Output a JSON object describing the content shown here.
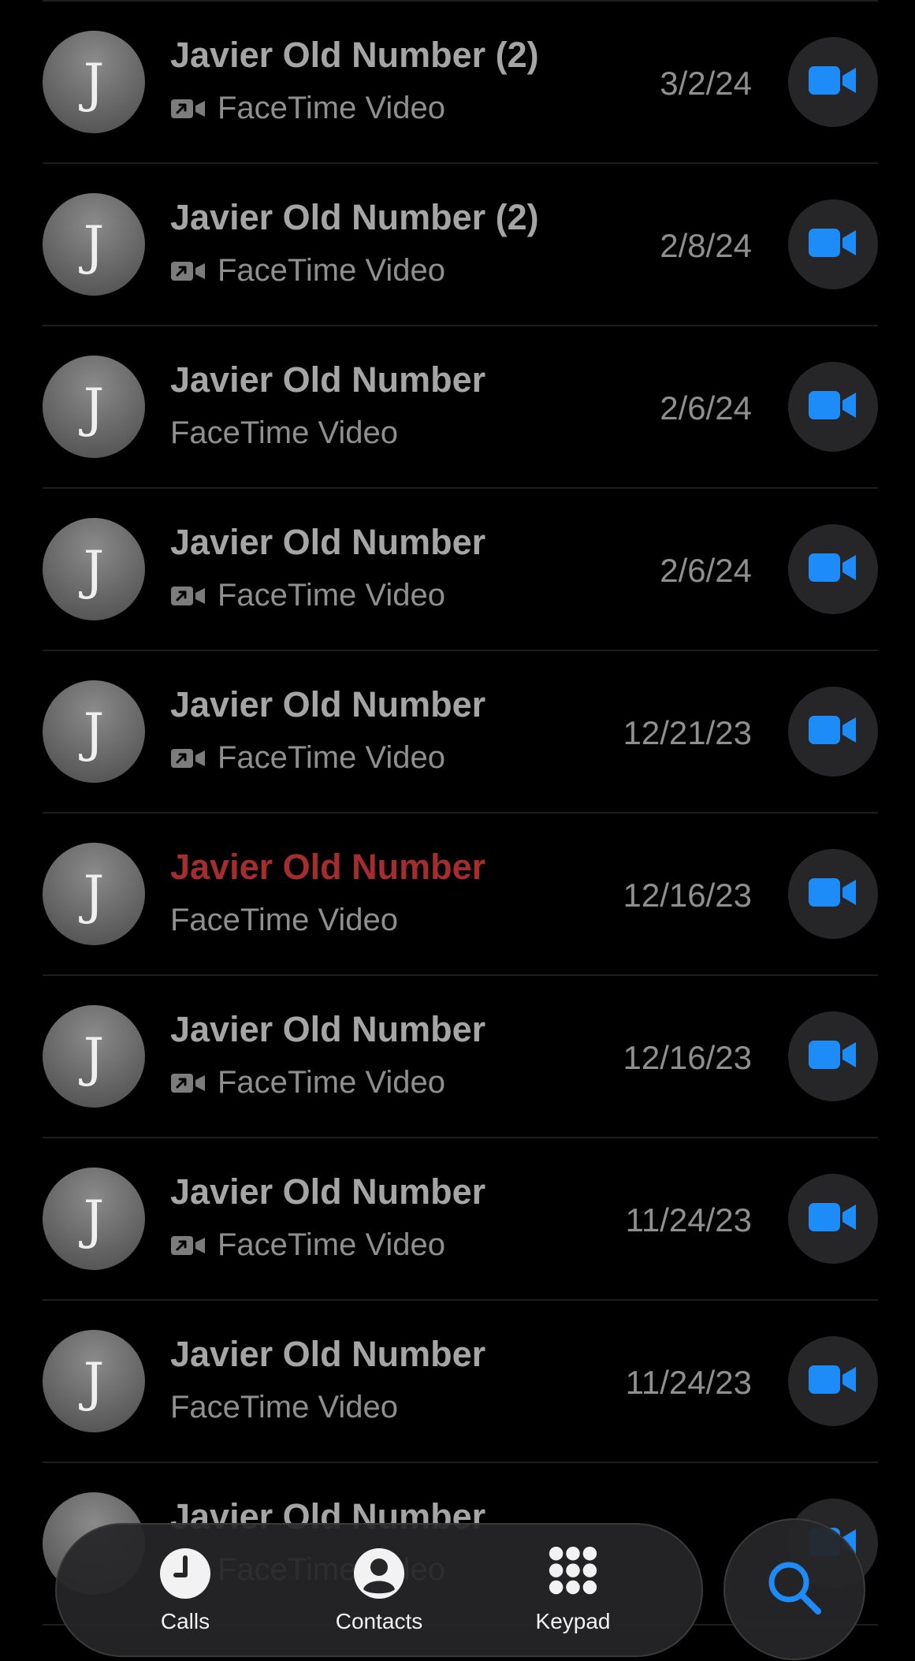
{
  "calls": [
    {
      "name": "Javier Old Number (2)",
      "type": "FaceTime Video",
      "date": "3/2/24",
      "outgoing": true,
      "missed": false,
      "initial": "J"
    },
    {
      "name": "Javier Old Number (2)",
      "type": "FaceTime Video",
      "date": "2/8/24",
      "outgoing": true,
      "missed": false,
      "initial": "J"
    },
    {
      "name": "Javier Old Number",
      "type": "FaceTime Video",
      "date": "2/6/24",
      "outgoing": false,
      "missed": false,
      "initial": "J"
    },
    {
      "name": "Javier Old Number",
      "type": "FaceTime Video",
      "date": "2/6/24",
      "outgoing": true,
      "missed": false,
      "initial": "J"
    },
    {
      "name": "Javier Old Number",
      "type": "FaceTime Video",
      "date": "12/21/23",
      "outgoing": true,
      "missed": false,
      "initial": "J"
    },
    {
      "name": "Javier Old Number",
      "type": "FaceTime Video",
      "date": "12/16/23",
      "outgoing": false,
      "missed": true,
      "initial": "J"
    },
    {
      "name": "Javier Old Number",
      "type": "FaceTime Video",
      "date": "12/16/23",
      "outgoing": true,
      "missed": false,
      "initial": "J"
    },
    {
      "name": "Javier Old Number",
      "type": "FaceTime Video",
      "date": "11/24/23",
      "outgoing": true,
      "missed": false,
      "initial": "J"
    },
    {
      "name": "Javier Old Number",
      "type": "FaceTime Video",
      "date": "11/24/23",
      "outgoing": false,
      "missed": false,
      "initial": "J"
    },
    {
      "name": "Javier Old Number",
      "type": "FaceTime Video",
      "date": "",
      "outgoing": true,
      "missed": false,
      "initial": ""
    }
  ],
  "tab_bar": {
    "calls_label": "Calls",
    "contacts_label": "Contacts",
    "keypad_label": "Keypad"
  },
  "icons": {
    "row_video": "video-camera-icon",
    "outgoing": "outgoing-video-call-icon",
    "calls_tab": "clock-icon",
    "contacts_tab": "person-circle-icon",
    "keypad_tab": "keypad-grid-icon",
    "search": "search-icon"
  },
  "colors": {
    "accent_blue": "#1d8cf8",
    "missed_red": "#a62d2d",
    "name_gray": "#a5a5a5",
    "secondary_gray": "#8f8f8f",
    "background": "#000000"
  }
}
